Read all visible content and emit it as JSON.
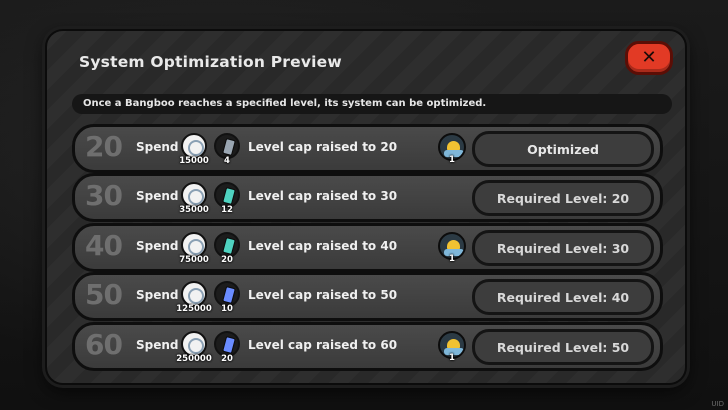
{
  "dialog": {
    "title": "System Optimization Preview",
    "close_label": "✕",
    "notice": "Once a Bangboo reaches a specified level, its system can be optimized."
  },
  "colors": {
    "close_button": "#e23a25",
    "row_bg": "#434343",
    "level_number": "#6f6f6f"
  },
  "rows": [
    {
      "level": "20",
      "spend_label": "Spend",
      "coin_qty": "15000",
      "chip_qty": "4",
      "chip_color": "#9aa6b2",
      "cap_text": "Level cap raised to 20",
      "has_reward": true,
      "reward_qty": "1",
      "status": "Optimized",
      "optimized": true
    },
    {
      "level": "30",
      "spend_label": "Spend",
      "coin_qty": "35000",
      "chip_qty": "12",
      "chip_color": "#4fd2c0",
      "cap_text": "Level cap raised to 30",
      "has_reward": false,
      "reward_qty": "",
      "status": "Required Level: 20",
      "optimized": false
    },
    {
      "level": "40",
      "spend_label": "Spend",
      "coin_qty": "75000",
      "chip_qty": "20",
      "chip_color": "#4fd2c0",
      "cap_text": "Level cap raised to 40",
      "has_reward": true,
      "reward_qty": "1",
      "status": "Required Level: 30",
      "optimized": false
    },
    {
      "level": "50",
      "spend_label": "Spend",
      "coin_qty": "125000",
      "chip_qty": "10",
      "chip_color": "#6a8cff",
      "cap_text": "Level cap raised to 50",
      "has_reward": false,
      "reward_qty": "",
      "status": "Required Level: 40",
      "optimized": false
    },
    {
      "level": "60",
      "spend_label": "Spend",
      "coin_qty": "250000",
      "chip_qty": "20",
      "chip_color": "#6a8cff",
      "cap_text": "Level cap raised to 60",
      "has_reward": true,
      "reward_qty": "1",
      "status": "Required Level: 50",
      "optimized": false
    }
  ],
  "footer": {
    "uid_label": "UID"
  }
}
